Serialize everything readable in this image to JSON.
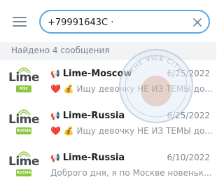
{
  "search": {
    "value": "+79991643С ·"
  },
  "results_header": "Найдено 4 сообщения",
  "results": [
    {
      "logo_word": "Lime",
      "logo_badge": "MSC",
      "title": "Lime-Moscow",
      "date": "6/25/2022",
      "emoji": "❤️ 💰",
      "preview": "Ищу девочку НЕ ИЗ ТЕМЫ до..."
    },
    {
      "logo_word": "Lime",
      "logo_badge": "RUSSIA",
      "title": "Lime-Russia",
      "date": "6/25/2022",
      "emoji": "❤️ 💰",
      "preview": "Ищу девочку НЕ ИЗ ТЕМЫ до..."
    },
    {
      "logo_word": "Lime",
      "logo_badge": "RUSSIA",
      "title": "Lime-Russia",
      "date": "6/10/2022",
      "emoji": "",
      "preview": "Доброго дня, я по Москве новеньк..."
    }
  ],
  "watermark_text": "THE VICE CITY",
  "colors": {
    "accent": "#5aa7e0",
    "lime": "#8cc63f",
    "header_bg": "#f1f3f5"
  },
  "icons": {
    "menu": "hamburger-icon",
    "clear": "close-icon",
    "speaker": "megaphone-icon"
  }
}
